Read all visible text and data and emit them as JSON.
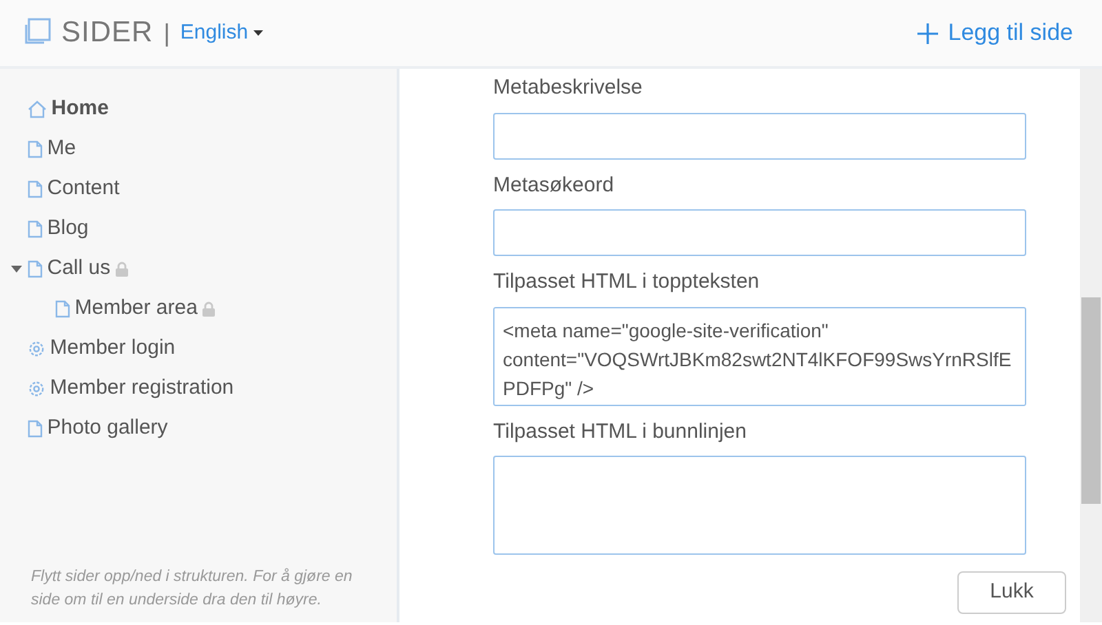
{
  "header": {
    "brand": "SIDER",
    "separator": "|",
    "language": "English",
    "add_button": "Legg til side"
  },
  "pages": [
    {
      "label": "Home",
      "kind": "home",
      "selected": true,
      "locked": false
    },
    {
      "label": "Me",
      "kind": "page",
      "selected": false,
      "locked": false
    },
    {
      "label": "Content",
      "kind": "page",
      "selected": false,
      "locked": false
    },
    {
      "label": "Blog",
      "kind": "page",
      "selected": false,
      "locked": false
    },
    {
      "label": "Call us",
      "kind": "page",
      "selected": false,
      "locked": true,
      "expanded": true,
      "children": [
        {
          "label": "Member area",
          "kind": "page",
          "selected": false,
          "locked": true
        }
      ]
    },
    {
      "label": "Member login",
      "kind": "settings",
      "selected": false,
      "locked": false
    },
    {
      "label": "Member registration",
      "kind": "settings",
      "selected": false,
      "locked": false
    },
    {
      "label": "Photo gallery",
      "kind": "page",
      "selected": false,
      "locked": false
    }
  ],
  "sidebar_hint": "Flytt sider opp/ned i strukturen. For å gjøre en side om til en underside dra den til høyre.",
  "fields": [
    {
      "label": "Metabeskrivelse",
      "kind": "input"
    },
    {
      "label": "Metasøkeord",
      "kind": "input"
    },
    {
      "label": "Tilpasset HTML i toppteksten",
      "kind": "textarea",
      "value": "<meta name=\"google-site-verification\" content=\"VOQSWrtJBKm82swt2NT4lKFOF99SwsYrnRSlfEPDFPg\" />"
    },
    {
      "label": "Tilpasset HTML i bunnlinjen",
      "kind": "textarea"
    }
  ],
  "close_button": "Lukk"
}
